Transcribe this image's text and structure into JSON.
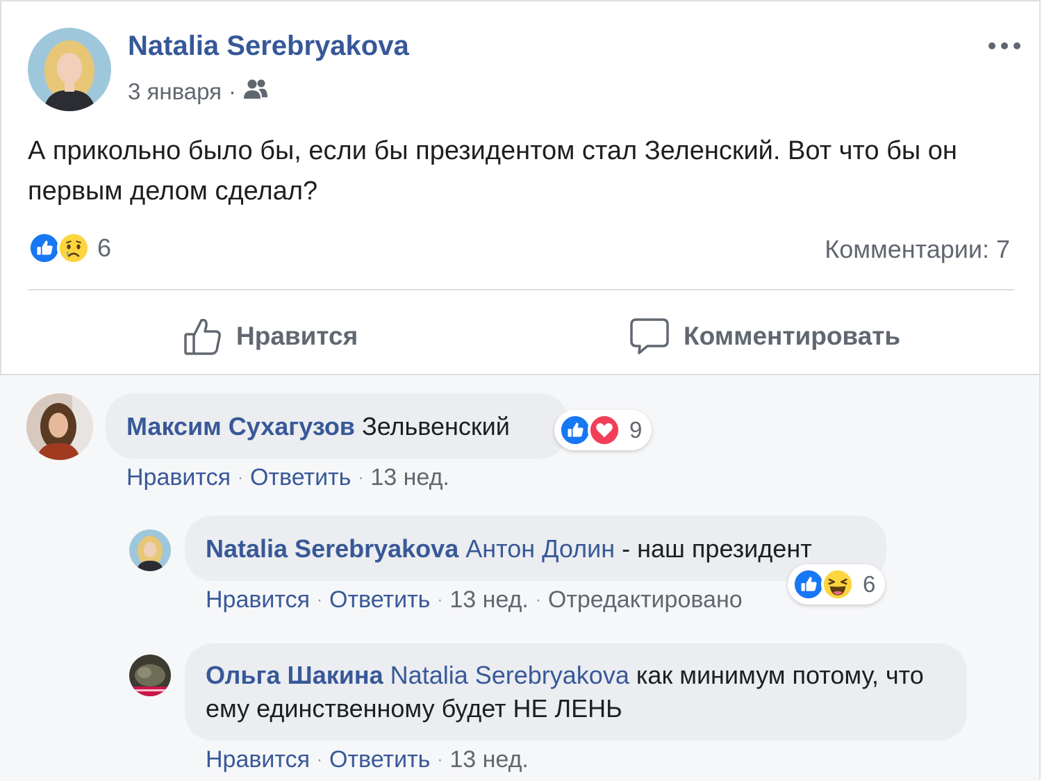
{
  "post": {
    "author": "Natalia Serebryakova",
    "date": "3 января",
    "meta_separator": "·",
    "text": "А прикольно было бы, если бы президентом стал Зеленский. Вот что бы он первым делом сделал?",
    "reactions": {
      "icons": [
        "like-icon",
        "sad-icon"
      ],
      "count": "6"
    },
    "comments_count": "Комментарии: 7",
    "actions": {
      "like": "Нравится",
      "comment": "Комментировать"
    }
  },
  "comments": [
    {
      "author": "Максим Сухагузов",
      "mention": "",
      "text": "Зельвенский",
      "reactions": {
        "icons": [
          "like-icon",
          "love-icon"
        ],
        "count": "9"
      },
      "like_label": "Нравится",
      "reply_label": "Ответить",
      "time": "13 нед."
    },
    {
      "author": "Natalia Serebryakova",
      "mention": "Антон Долин",
      "text": "- наш президент",
      "reactions": {
        "icons": [
          "like-icon",
          "haha-icon"
        ],
        "count": "6"
      },
      "like_label": "Нравится",
      "reply_label": "Ответить",
      "time": "13 нед.",
      "edited": "Отредактировано"
    },
    {
      "author": "Ольга Шакина",
      "mention": "Natalia Serebryakova",
      "text": "как минимум потому, что ему единственному будет НЕ ЛЕНЬ",
      "like_label": "Нравится",
      "reply_label": "Ответить",
      "time": "13 нед."
    }
  ],
  "colors": {
    "link": "#385898",
    "like_blue": "#1877f2",
    "love_red": "#f33e58",
    "emoji_yellow": "#fcd53f",
    "bubble_bg": "#ebedf0",
    "muted_text": "#616770"
  }
}
